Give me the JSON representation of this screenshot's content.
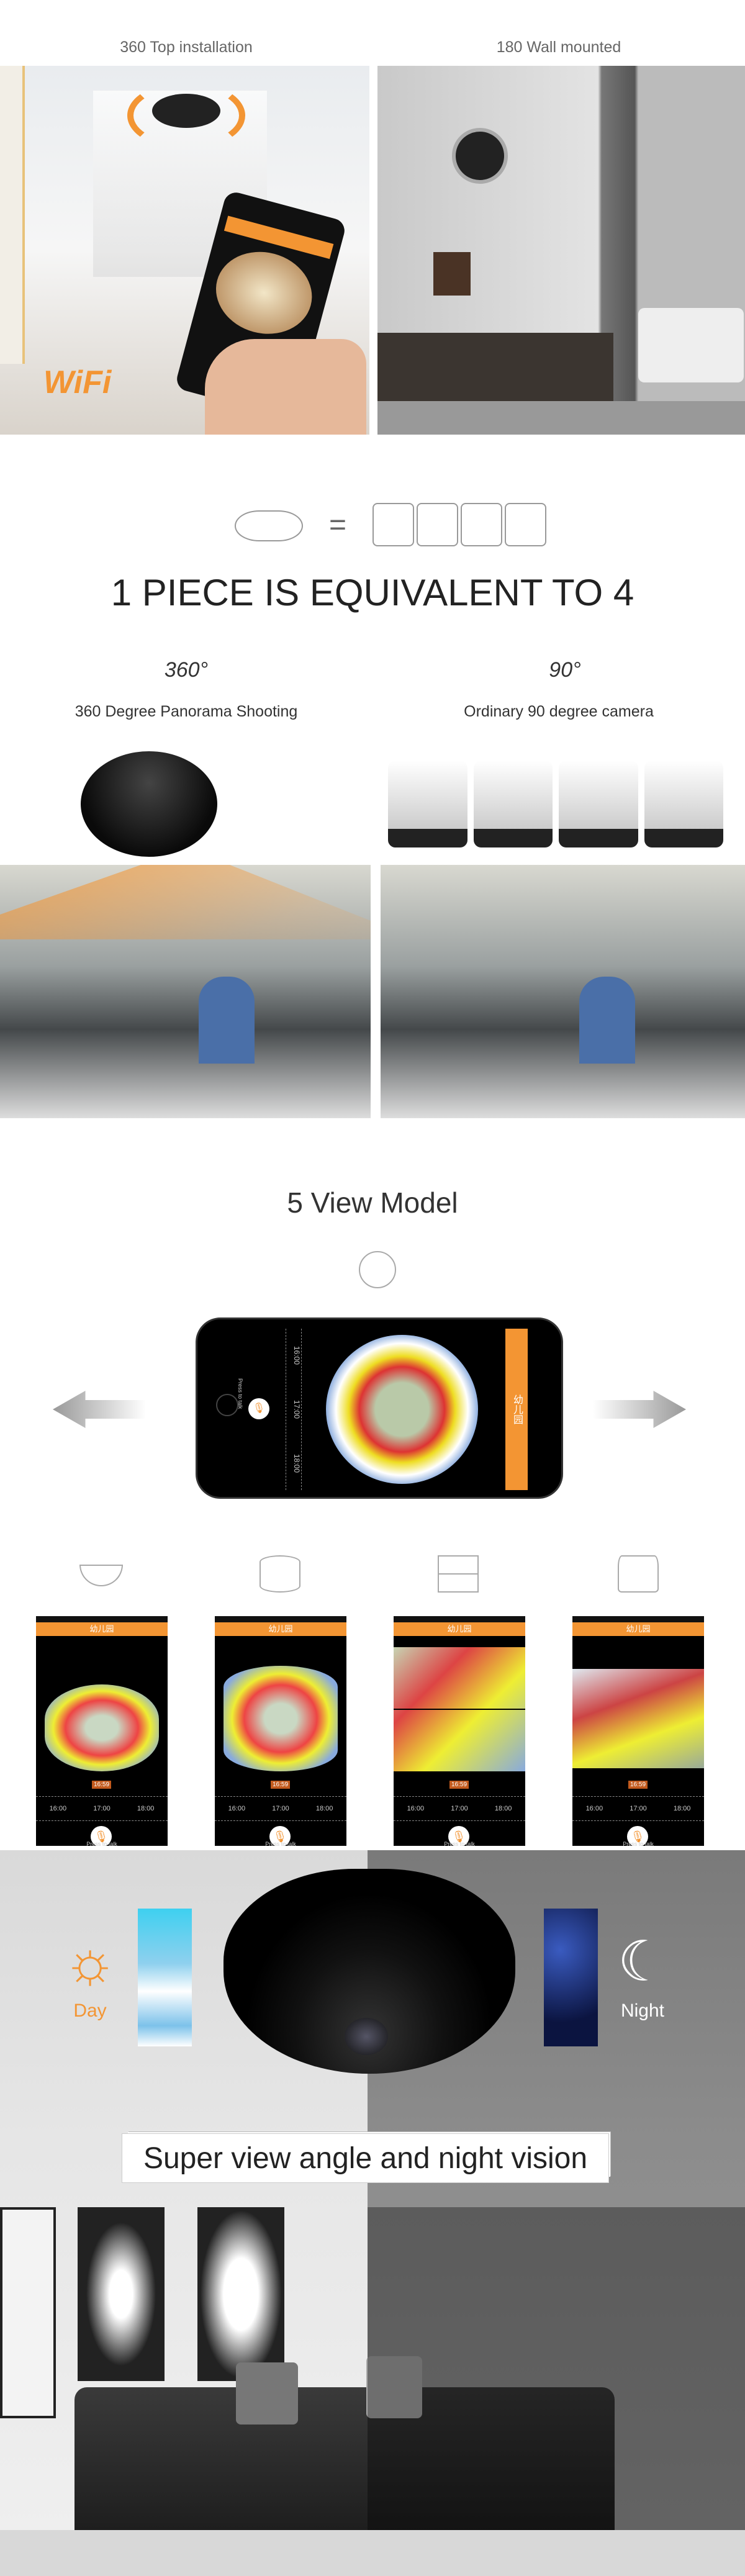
{
  "install": {
    "left_label": "360 Top installation",
    "right_label": "180 Wall mounted",
    "wifi_logo": "WiFi"
  },
  "equivalence": {
    "equals": "=",
    "headline": "1 PIECE IS EQUIVALENT TO 4",
    "left_icon": "360-rotation-icon",
    "left_icon_text": "360°",
    "left_caption": "360 Degree Panorama Shooting",
    "right_icon": "90-degree-icon",
    "right_icon_text": "90°",
    "right_caption": "Ordinary 90 degree camera"
  },
  "view_model": {
    "title": "5 View Model",
    "app": {
      "header_title": "幼儿园",
      "timeline": [
        "16:00",
        "17:00",
        "18:00"
      ],
      "current_time": "16:59",
      "talk_label": "Press to talk"
    },
    "mode_icons": [
      "bowl-view-icon",
      "cylinder-view-icon",
      "quad-split-view-icon",
      "panorama-view-icon"
    ]
  },
  "day_night": {
    "day_label": "Day",
    "night_label": "Night",
    "banner": "Super view angle and night vision",
    "colors": {
      "day": "#f39533",
      "night": "#ffffff"
    }
  },
  "colors": {
    "accent": "#f39533"
  }
}
